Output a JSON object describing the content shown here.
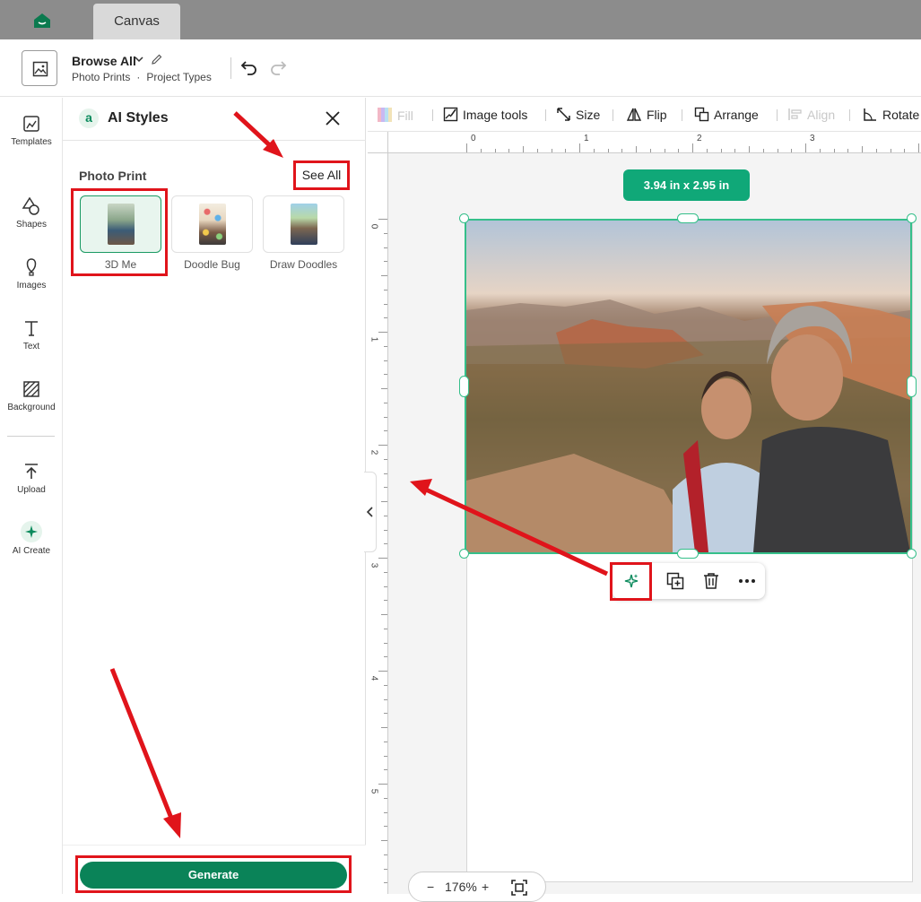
{
  "tabbar": {
    "tab_label": "Canvas"
  },
  "header": {
    "project_title": "Browse All",
    "breadcrumb_1": "Photo Prints",
    "breadcrumb_sep": "·",
    "breadcrumb_2": "Project Types"
  },
  "rail": {
    "items": [
      {
        "label": "Templates",
        "icon": "templates-icon"
      },
      {
        "label": "Shapes",
        "icon": "shapes-icon"
      },
      {
        "label": "Images",
        "icon": "images-icon"
      },
      {
        "label": "Text",
        "icon": "text-icon"
      },
      {
        "label": "Background",
        "icon": "background-icon"
      },
      {
        "label": "Upload",
        "icon": "upload-icon"
      },
      {
        "label": "AI Create",
        "icon": "sparkle-icon"
      }
    ]
  },
  "panel": {
    "logo_letter": "a",
    "title": "AI Styles",
    "section": "Photo Print",
    "see_all": "See All",
    "styles": [
      {
        "name": "3D Me",
        "selected": true
      },
      {
        "name": "Doodle Bug",
        "selected": false
      },
      {
        "name": "Draw Doodles",
        "selected": false
      }
    ],
    "generate": "Generate"
  },
  "toolbar": {
    "fill": "Fill",
    "image_tools": "Image tools",
    "size": "Size",
    "flip": "Flip",
    "arrange": "Arrange",
    "align": "Align",
    "rotate": "Rotate"
  },
  "rulers": {
    "top": [
      "0",
      "1",
      "2",
      "3"
    ],
    "left": [
      "0",
      "1",
      "2",
      "3",
      "4",
      "5"
    ]
  },
  "canvas": {
    "size_badge": "3.94  in x 2.95  in"
  },
  "zoom": {
    "minus": "−",
    "level": "176%",
    "plus": "+"
  },
  "colors": {
    "accent_green": "#0a8358",
    "selection_green": "#35bf8a",
    "highlight_red": "#e0141b"
  }
}
